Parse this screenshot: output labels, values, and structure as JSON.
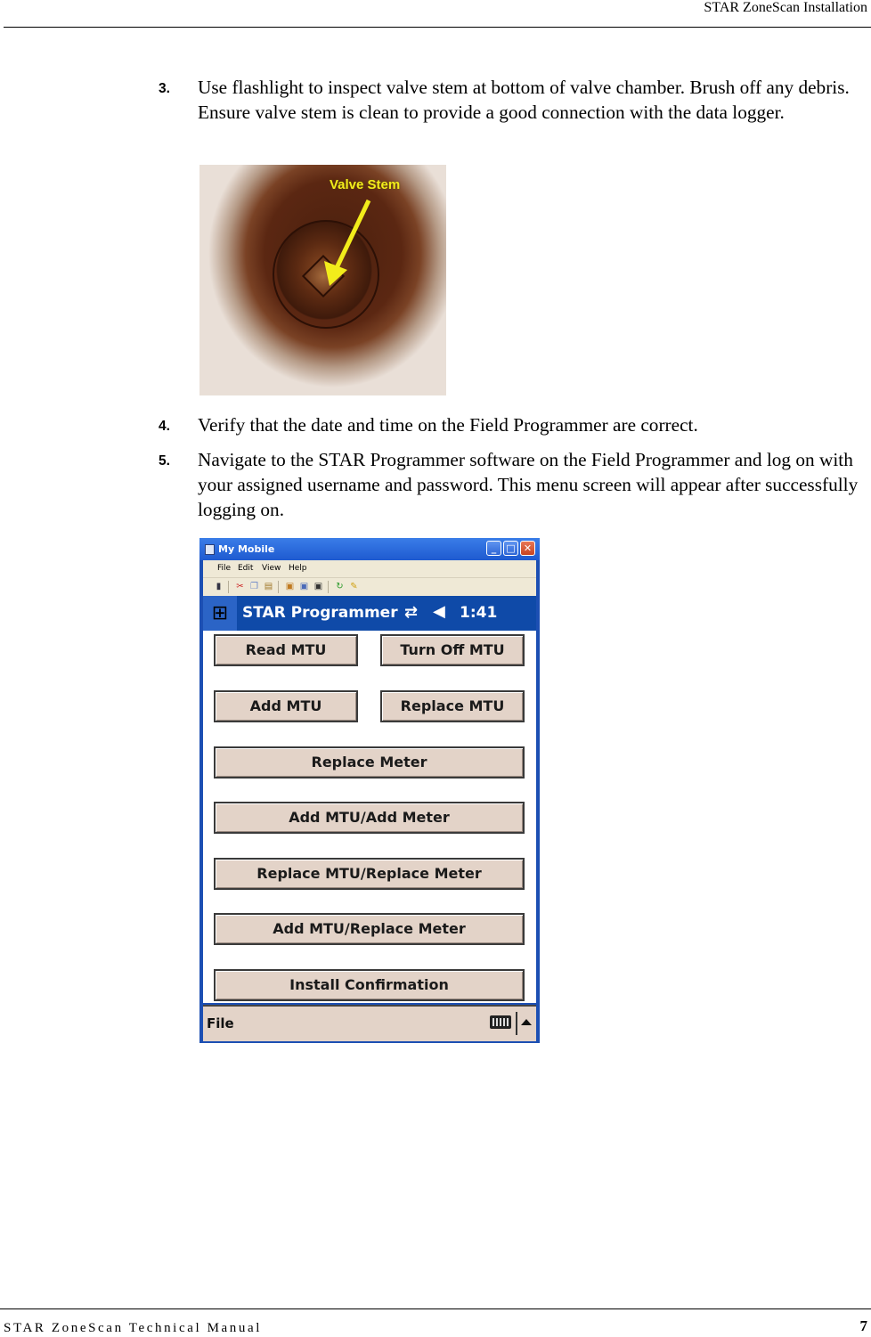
{
  "header": {
    "title": "STAR ZoneScan Installation"
  },
  "footer": {
    "manual_title": "STAR ZoneScan Technical Manual",
    "page_number": "7"
  },
  "steps": [
    {
      "number": "3.",
      "text": "Use flashlight to inspect valve stem at bottom of valve chamber. Brush off any debris. Ensure valve stem is clean to provide a good connection with the data logger."
    },
    {
      "number": "4.",
      "text": "Verify that the date and time on the Field Programmer are correct."
    },
    {
      "number": "5.",
      "text": "Navigate to the STAR Programmer software on the Field Programmer and log on with your assigned username and password. This menu screen will appear after successfully logging on."
    }
  ],
  "photo": {
    "callout_label": "Valve Stem"
  },
  "device": {
    "window_title": "My Mobile",
    "window_buttons": {
      "minimize": "_",
      "maximize": "□",
      "close": "✕"
    },
    "menu": [
      "File",
      "Edit",
      "View",
      "Help"
    ],
    "toolbar_icons": [
      "device-icon",
      "cut-icon",
      "copy-icon",
      "paste-icon",
      "explore-icon",
      "copy-file-icon",
      "delete-icon",
      "sync-icon",
      "clean-icon"
    ],
    "app_title": "STAR Programmer",
    "status": {
      "sync_glyph": "⇄",
      "volume_glyph": "◀",
      "time": "1:41"
    },
    "buttons": {
      "read_mtu": "Read MTU",
      "turn_off_mtu": "Turn Off MTU",
      "add_mtu": "Add MTU",
      "replace_mtu": "Replace MTU",
      "replace_meter": "Replace Meter",
      "add_mtu_add_meter": "Add MTU/Add Meter",
      "replace_mtu_replace_meter": "Replace MTU/Replace Meter",
      "add_mtu_replace_meter": "Add MTU/Replace Meter",
      "install_confirmation": "Install Confirmation"
    },
    "command_bar": {
      "file_menu": "File"
    }
  }
}
